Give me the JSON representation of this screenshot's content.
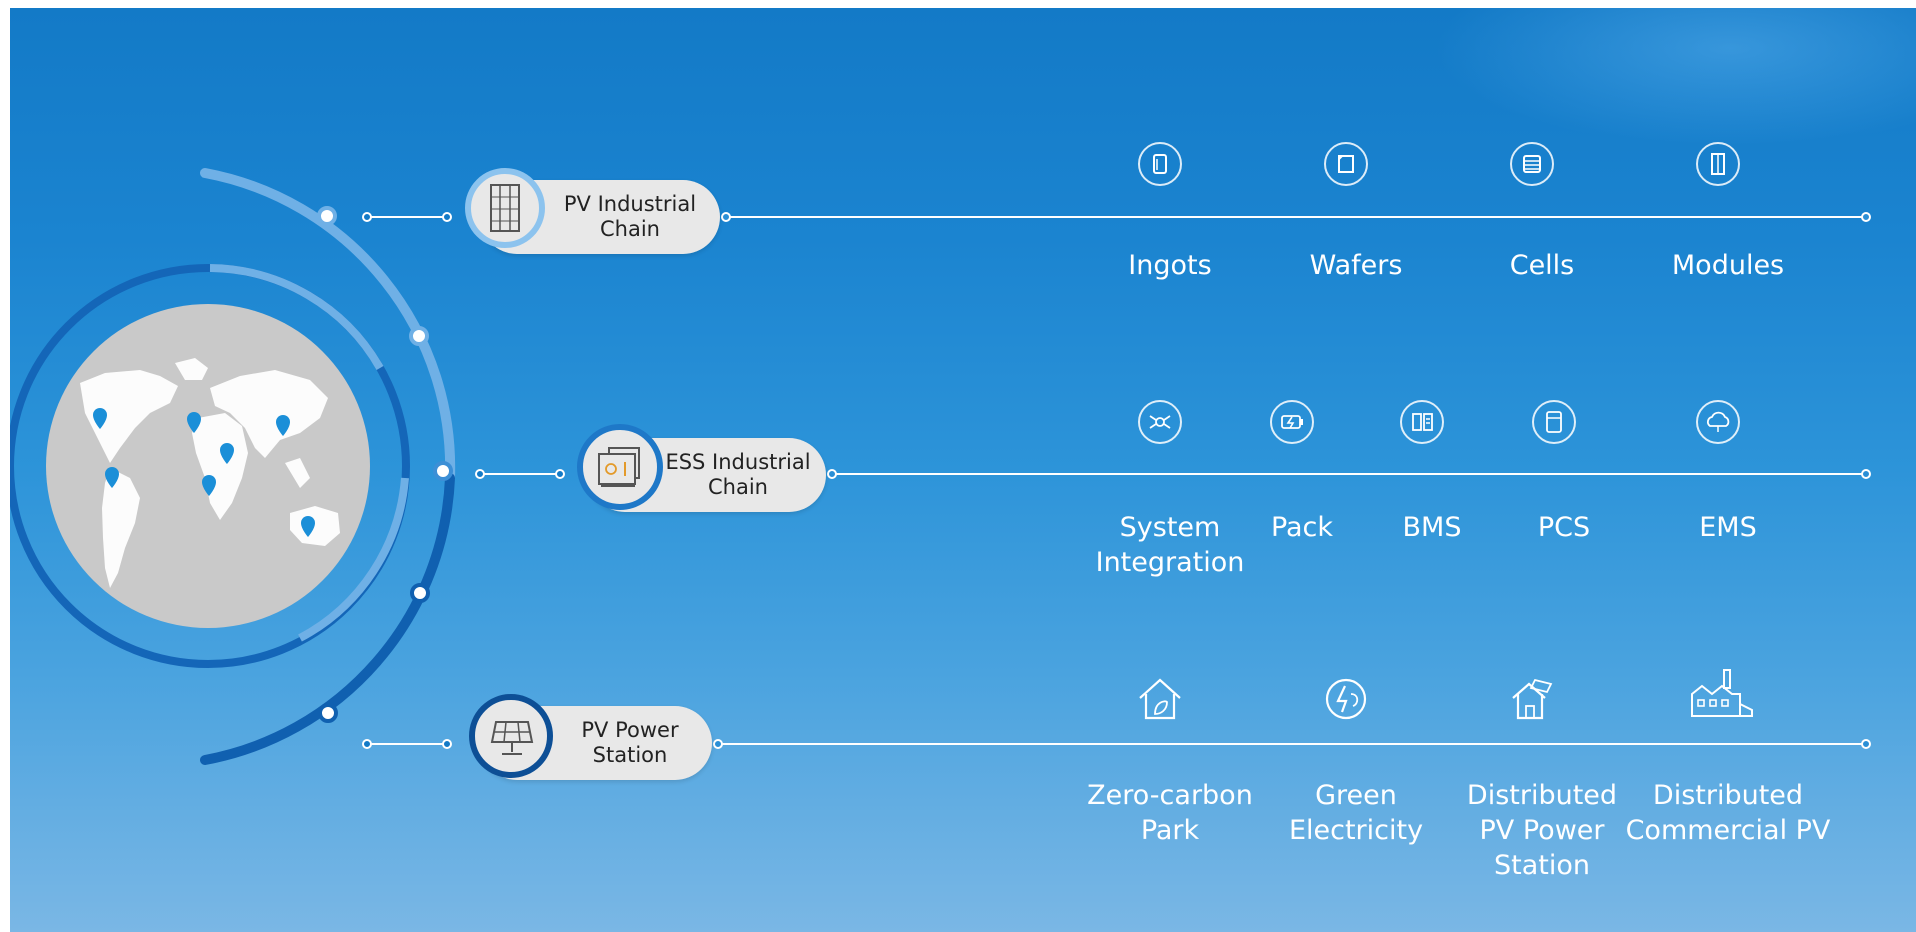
{
  "chains": [
    {
      "id": "pv-industrial-chain",
      "label_lines": [
        "PV Industrial",
        "Chain"
      ],
      "items": [
        {
          "lines": [
            "Ingots"
          ],
          "icon": "ingot-icon"
        },
        {
          "lines": [
            "Wafers"
          ],
          "icon": "wafer-icon"
        },
        {
          "lines": [
            "Cells"
          ],
          "icon": "cell-icon"
        },
        {
          "lines": [
            "Modules"
          ],
          "icon": "module-icon"
        }
      ]
    },
    {
      "id": "ess-industrial-chain",
      "label_lines": [
        "ESS Industrial",
        "Chain"
      ],
      "items": [
        {
          "lines": [
            "System",
            "Integration"
          ],
          "icon": "system-integration-icon"
        },
        {
          "lines": [
            "Pack"
          ],
          "icon": "battery-pack-icon"
        },
        {
          "lines": [
            "BMS"
          ],
          "icon": "bms-icon"
        },
        {
          "lines": [
            "PCS"
          ],
          "icon": "pcs-icon"
        },
        {
          "lines": [
            "EMS"
          ],
          "icon": "ems-cloud-icon"
        }
      ]
    },
    {
      "id": "pv-power-station",
      "label_lines": [
        "PV Power",
        "Station"
      ],
      "items": [
        {
          "lines": [
            "Zero-carbon",
            "Park"
          ],
          "icon": "zero-carbon-house-icon"
        },
        {
          "lines": [
            "Green",
            "Electricity"
          ],
          "icon": "green-electricity-icon"
        },
        {
          "lines": [
            "Distributed",
            "PV Power",
            "Station"
          ],
          "icon": "rooftop-pv-house-icon"
        },
        {
          "lines": [
            "Distributed",
            "Commercial PV"
          ],
          "icon": "commercial-factory-icon"
        }
      ]
    }
  ],
  "colors": {
    "bg_top": "#137ac7",
    "bg_bottom": "#7ab7e5",
    "globe": "#c9c9c9",
    "ring_dark": "#1060b0",
    "ring_light": "#6fb0e6",
    "pin": "#1b8fd8",
    "pill": "#e8e8e8"
  }
}
